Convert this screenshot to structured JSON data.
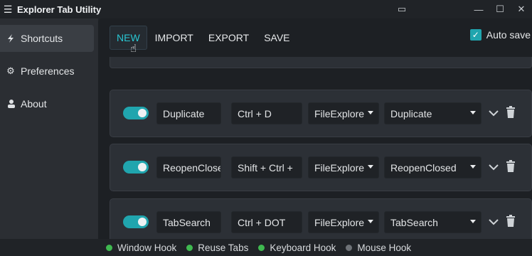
{
  "window": {
    "title": "Explorer Tab Utility",
    "menu_icon": "hamburger-icon",
    "controls": [
      "window-snap-icon",
      "minimize-icon",
      "maximize-icon",
      "close-icon"
    ],
    "control_glyphs": [
      "▭",
      "—",
      "☐",
      "✕"
    ]
  },
  "sidebar": {
    "items": [
      {
        "label": "Shortcuts",
        "icon": "lightning-icon",
        "glyph": "⚡",
        "active": true
      },
      {
        "label": "Preferences",
        "icon": "gear-icon",
        "glyph": "⚙",
        "active": false
      },
      {
        "label": "About",
        "icon": "person-icon",
        "glyph": "👤",
        "active": false
      }
    ]
  },
  "toolbar": {
    "new_label": "NEW",
    "import_label": "IMPORT",
    "export_label": "EXPORT",
    "save_label": "SAVE",
    "auto_save_label": "Auto save",
    "auto_save_checked": true,
    "cursor_icon": "hand-pointer-icon"
  },
  "shortcuts": [
    {
      "enabled": true,
      "name": "Duplicate",
      "keys": "Ctrl + D",
      "target": "FileExplorer",
      "action": "Duplicate"
    },
    {
      "enabled": true,
      "name": "ReopenClose",
      "keys": "Shift + Ctrl +",
      "target": "FileExplorer",
      "action": "ReopenClosed"
    },
    {
      "enabled": true,
      "name": "TabSearch",
      "keys": "Ctrl + DOT",
      "target": "FileExplorer",
      "action": "TabSearch"
    }
  ],
  "shortcut_target_display": [
    "FileExplore",
    "FileExplore",
    "FileExplore"
  ],
  "row_icons": {
    "expand": "chevron-down-icon",
    "delete": "trash-icon"
  },
  "status": [
    {
      "label": "Window Hook",
      "color": "#3fb950"
    },
    {
      "label": "Reuse Tabs",
      "color": "#3fb950"
    },
    {
      "label": "Keyboard Hook",
      "color": "#3fb950"
    },
    {
      "label": "Mouse Hook",
      "color": "#6e7277"
    }
  ],
  "colors": {
    "accent": "#20a5ae",
    "accent_text": "#29c6d2",
    "status_on": "#3fb950",
    "status_off": "#6e7277"
  }
}
